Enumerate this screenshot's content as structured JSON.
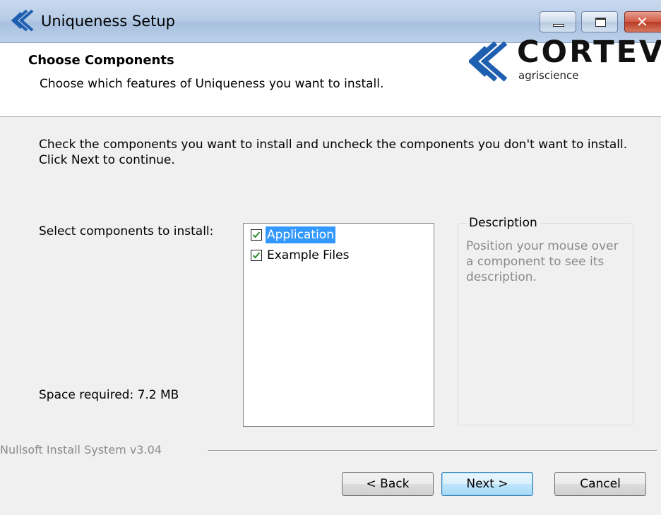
{
  "window": {
    "title": "Uniqueness Setup",
    "controls": {
      "minimize": "minimize",
      "maximize": "maximize",
      "close": "close"
    }
  },
  "header": {
    "title": "Choose Components",
    "subtitle": "Choose which features of Uniqueness you want to install.",
    "logo": {
      "name": "CORTEVA",
      "tagline": "agriscience"
    }
  },
  "body": {
    "intro": "Check the components you want to install and uncheck the components you don't want to install. Click Next to continue.",
    "select_label": "Select components to install:",
    "space_required": "Space required: 7.2 MB",
    "components": [
      {
        "label": "Application",
        "checked": true,
        "selected": true
      },
      {
        "label": "Example Files",
        "checked": true,
        "selected": false
      }
    ],
    "description": {
      "legend": "Description",
      "text": "Position your mouse over a component to see its description."
    }
  },
  "footer": {
    "branding": "Nullsoft Install System v3.04",
    "back_label": "< Back",
    "next_label": "Next >",
    "cancel_label": "Cancel"
  },
  "colors": {
    "selection": "#3399ff",
    "check_mark": "#2e8b2e",
    "titlebar": "#b9cde6"
  }
}
